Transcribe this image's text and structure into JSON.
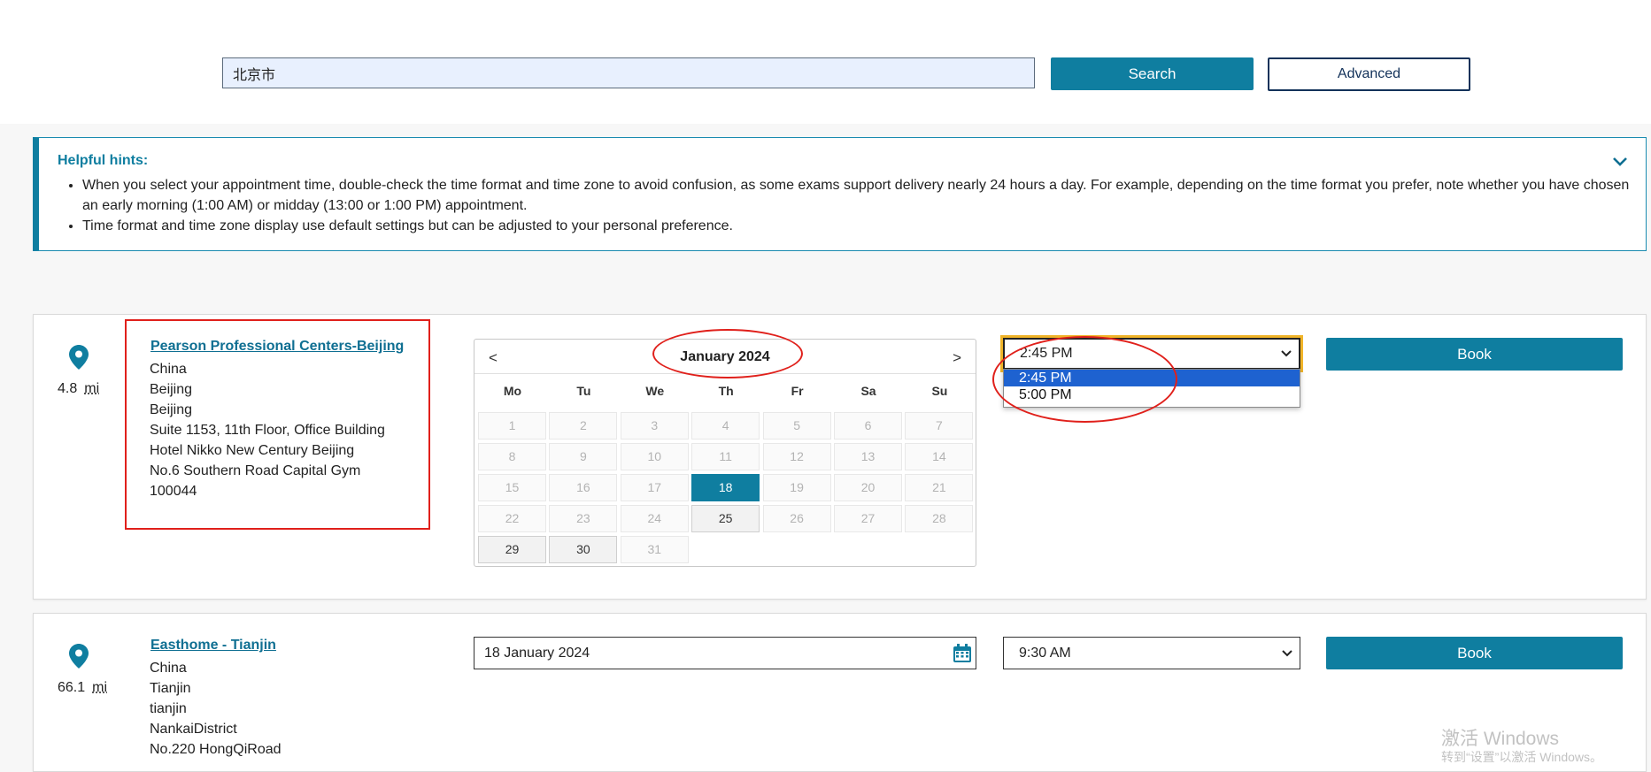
{
  "search": {
    "value": "北京市",
    "search_label": "Search",
    "advanced_label": "Advanced"
  },
  "hints": {
    "title": "Helpful hints:",
    "items": [
      "When you select your appointment time, double-check the time format and time zone to avoid confusion, as some exams support delivery nearly 24 hours a day. For example, depending on the time format you prefer, note whether you have chosen an early morning (1:00 AM) or midday (13:00 or 1:00 PM) appointment.",
      "Time format and time zone display use default settings but can be adjusted to your personal preference."
    ]
  },
  "results": [
    {
      "distance": "4.8",
      "unit": "mi",
      "name": "Pearson Professional Centers-Beijing",
      "address": [
        "China",
        "Beijing",
        "Beijing",
        "Suite 1153, 11th Floor, Office Building",
        "Hotel Nikko New Century Beijing",
        "No.6 Southern Road Capital Gym",
        "100044"
      ],
      "calendar": {
        "prev": "<",
        "next": ">",
        "month_label": "January 2024",
        "weekdays": [
          "Mo",
          "Tu",
          "We",
          "Th",
          "Fr",
          "Sa",
          "Su"
        ],
        "days": [
          "1",
          "2",
          "3",
          "4",
          "5",
          "6",
          "7",
          "8",
          "9",
          "10",
          "11",
          "12",
          "13",
          "14",
          "15",
          "16",
          "17",
          "18",
          "19",
          "20",
          "21",
          "22",
          "23",
          "24",
          "25",
          "26",
          "27",
          "28",
          "29",
          "30",
          "31"
        ],
        "available_days": [
          "25",
          "29",
          "30"
        ],
        "selected_day": "18"
      },
      "time_select": {
        "value": "2:45 PM",
        "options": [
          "2:45 PM",
          "5:00 PM"
        ],
        "highlighted_option": "2:45 PM"
      },
      "book_label": "Book"
    },
    {
      "distance": "66.1",
      "unit": "mi",
      "name": "Easthome - Tianjin",
      "address": [
        "China",
        "Tianjin",
        "tianjin",
        "NankaiDistrict",
        "No.220 HongQiRoad"
      ],
      "date_value": "18 January 2024",
      "time_select": {
        "value": "9:30 AM"
      },
      "book_label": "Book"
    }
  ],
  "watermark": {
    "line1": "激活 Windows",
    "line2": "转到“设置”以激活 Windows。"
  },
  "colors": {
    "accent": "#0f7ea0",
    "focus_outline": "#f0b429",
    "annotation_red": "#e0201b",
    "option_highlight": "#1e62d0"
  }
}
